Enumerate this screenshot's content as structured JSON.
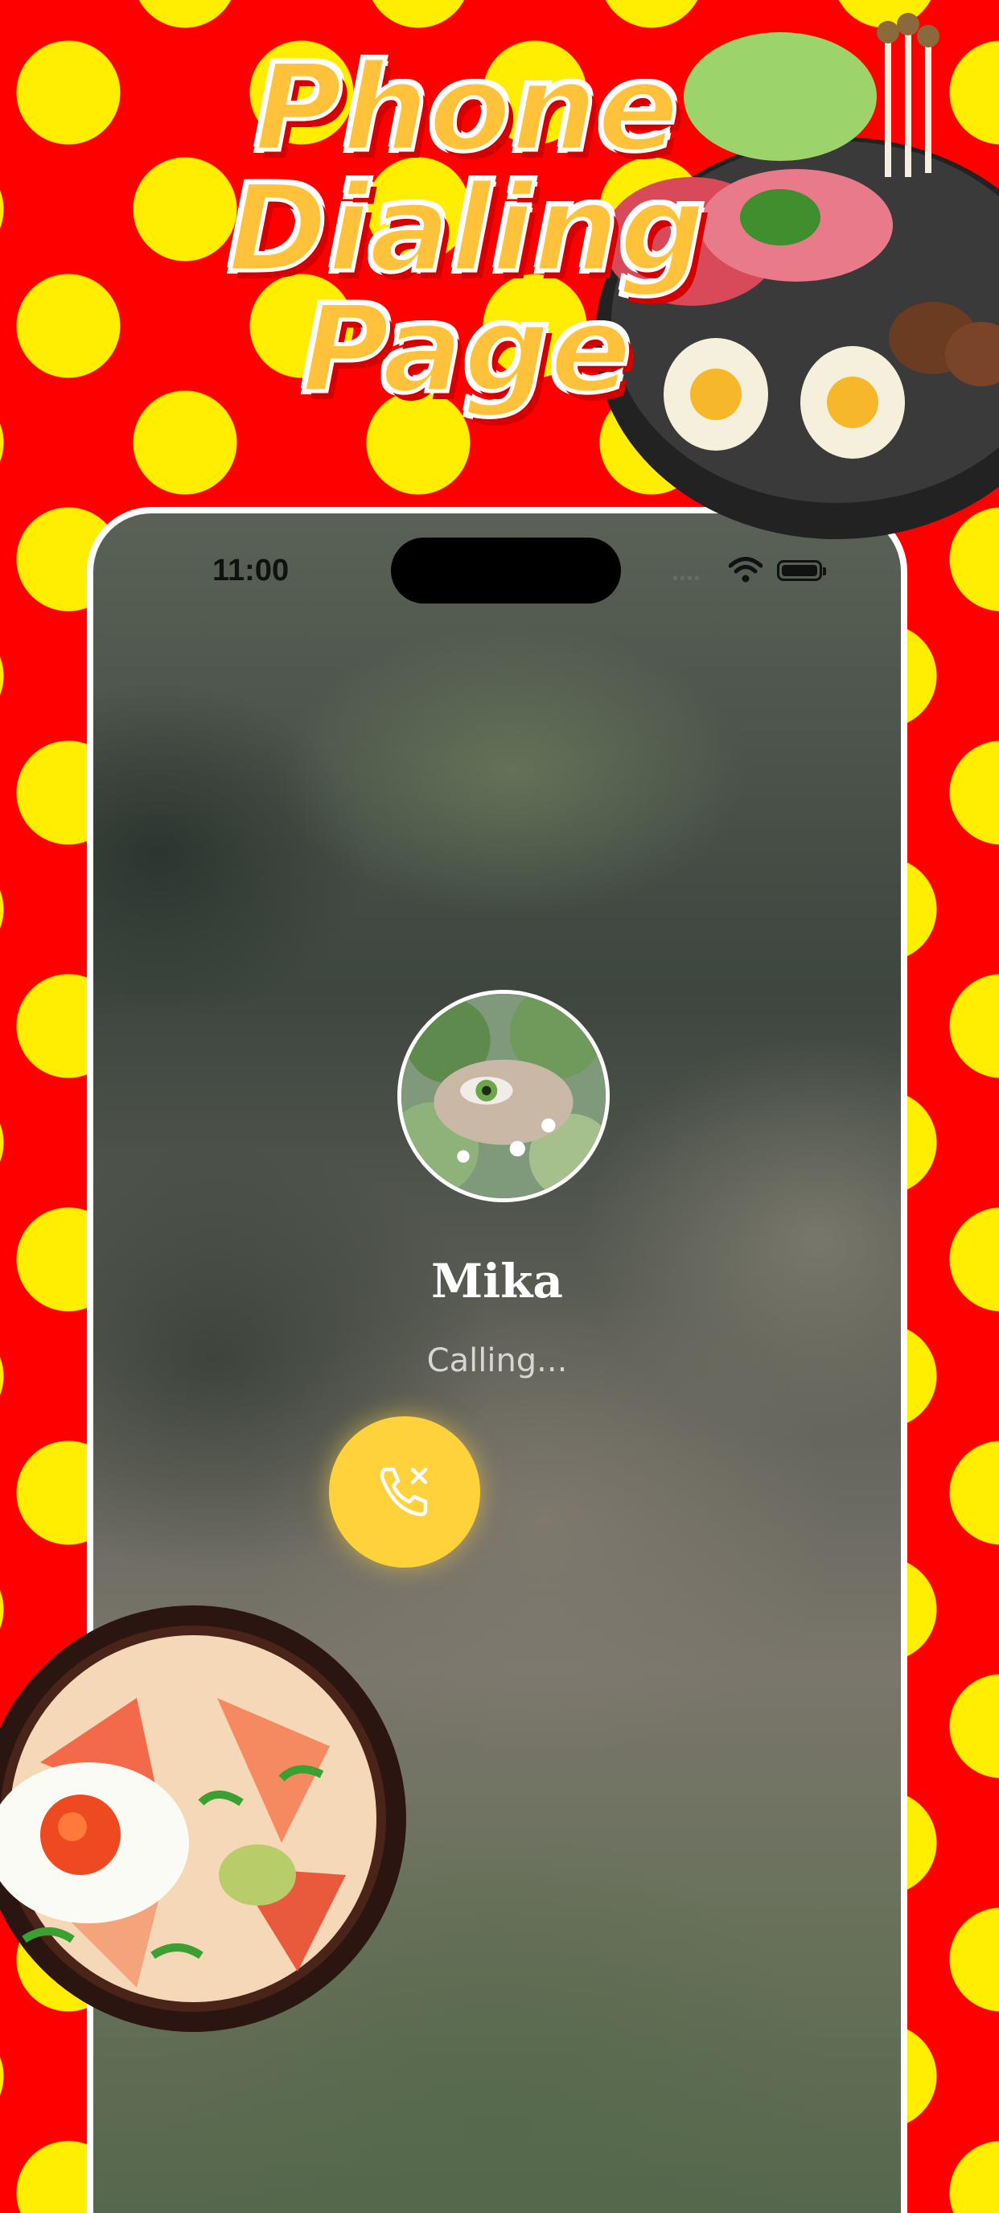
{
  "banner": {
    "title_line1": "Phone",
    "title_line2": "Dialing",
    "title_line3": "Page"
  },
  "status_bar": {
    "time": "11:00",
    "signal": "••••"
  },
  "call": {
    "contact_name": "Mika",
    "status": "Calling..."
  },
  "icons": {
    "end_call": "phone-hangup-icon",
    "wifi": "wifi-icon",
    "battery": "battery-icon"
  },
  "colors": {
    "background_red": "#ff0000",
    "polka_yellow": "#ffee00",
    "title_orange": "#ffc23a",
    "end_call_yellow": "#ffd13b",
    "name_text": "#ffffff"
  }
}
